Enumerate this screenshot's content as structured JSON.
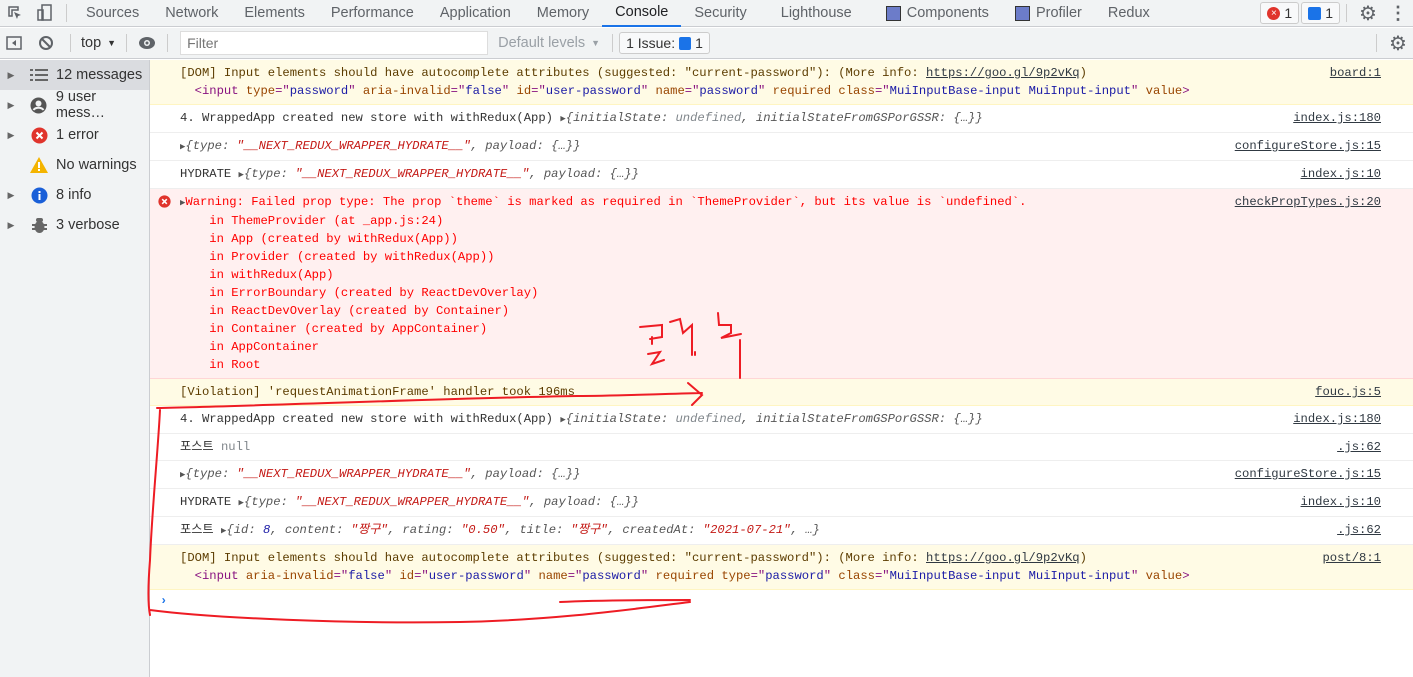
{
  "tabs": [
    "Sources",
    "Network",
    "Elements",
    "Performance",
    "Application",
    "Memory",
    "Console",
    "Security",
    "Lighthouse",
    "Components",
    "Profiler",
    "Redux"
  ],
  "active_tab": "Console",
  "error_count": "1",
  "issue_count": "1",
  "toolbar": {
    "context": "top",
    "filter_placeholder": "Filter",
    "levels": "Default levels",
    "issues_label": "1 Issue:",
    "issues_count": "1"
  },
  "sidebar": [
    {
      "label": "12 messages",
      "icon": "list-icon"
    },
    {
      "label": "9 user mess…",
      "icon": "user-icon"
    },
    {
      "label": "1 error",
      "icon": "error-icon"
    },
    {
      "label": "No warnings",
      "icon": "warning-icon"
    },
    {
      "label": "8 info",
      "icon": "info-icon"
    },
    {
      "label": "3 verbose",
      "icon": "bug-icon"
    }
  ],
  "messages": [
    {
      "kind": "warn",
      "source": "board:1",
      "lines": [
        [
          [
            "[DOM] Input elements should have autocomplete attributes (suggested: \"current-password\"): (More info: ",
            ""
          ],
          [
            "https://goo.gl/9p2vKq",
            "lnk"
          ],
          [
            ")",
            ""
          ]
        ],
        [
          [
            "  <input ",
            "tg"
          ],
          [
            "type",
            "at"
          ],
          [
            "=\"",
            "tg"
          ],
          [
            "password",
            "av"
          ],
          [
            "\" ",
            "tg"
          ],
          [
            "aria-invalid",
            "at"
          ],
          [
            "=\"",
            "tg"
          ],
          [
            "false",
            "av"
          ],
          [
            "\" ",
            "tg"
          ],
          [
            "id",
            "at"
          ],
          [
            "=\"",
            "tg"
          ],
          [
            "user-password",
            "av"
          ],
          [
            "\" ",
            "tg"
          ],
          [
            "name",
            "at"
          ],
          [
            "=\"",
            "tg"
          ],
          [
            "password",
            "av"
          ],
          [
            "\" ",
            "tg"
          ],
          [
            "required class",
            "at"
          ],
          [
            "=\"",
            "tg"
          ],
          [
            "MuiInputBase-input MuiInput-input",
            "av"
          ],
          [
            "\" ",
            "tg"
          ],
          [
            "value",
            "at"
          ],
          [
            ">",
            "tg"
          ]
        ]
      ]
    },
    {
      "kind": "log",
      "source": "index.js:180",
      "lines": [
        [
          [
            "4. WrappedApp created new store with withRedux(App) ",
            ""
          ],
          [
            "▶",
            "tri"
          ],
          [
            "{",
            "k"
          ],
          [
            "initialState: ",
            "k"
          ],
          [
            "undefined",
            "u"
          ],
          [
            ", initialStateFromGSPorGSSR: {…}}",
            "k"
          ]
        ]
      ]
    },
    {
      "kind": "log",
      "source": "configureStore.js:15",
      "lines": [
        [
          [
            "▶",
            "tri"
          ],
          [
            "{type: ",
            "k"
          ],
          [
            "\"__NEXT_REDUX_WRAPPER_HYDRATE__\"",
            "s"
          ],
          [
            ", payload: {…}}",
            "k"
          ]
        ]
      ]
    },
    {
      "kind": "log",
      "source": "index.js:10",
      "lines": [
        [
          [
            "HYDRATE ",
            ""
          ],
          [
            "▶",
            "tri"
          ],
          [
            "{type: ",
            "k"
          ],
          [
            "\"__NEXT_REDUX_WRAPPER_HYDRATE__\"",
            "s"
          ],
          [
            ", payload: {…}}",
            "k"
          ]
        ]
      ]
    },
    {
      "kind": "err",
      "source": "checkPropTypes.js:20",
      "lines": [
        [
          [
            "▶",
            "tri"
          ],
          [
            "Warning: Failed prop type: The prop `theme` is marked as required in `ThemeProvider`, but its value is `undefined`.",
            ""
          ]
        ],
        [
          [
            "    in ThemeProvider (at _app.js:24)",
            ""
          ]
        ],
        [
          [
            "    in App (created by withRedux(App))",
            ""
          ]
        ],
        [
          [
            "    in Provider (created by withRedux(App))",
            ""
          ]
        ],
        [
          [
            "    in withRedux(App)",
            ""
          ]
        ],
        [
          [
            "    in ErrorBoundary (created by ReactDevOverlay)",
            ""
          ]
        ],
        [
          [
            "    in ReactDevOverlay (created by Container)",
            ""
          ]
        ],
        [
          [
            "    in Container (created by AppContainer)",
            ""
          ]
        ],
        [
          [
            "    in AppContainer",
            ""
          ]
        ],
        [
          [
            "    in Root",
            ""
          ]
        ]
      ]
    },
    {
      "kind": "warn",
      "source": "fouc.js:5",
      "lines": [
        [
          [
            "[Violation] 'requestAnimationFrame' handler took 196ms",
            ""
          ]
        ]
      ]
    },
    {
      "kind": "log",
      "source": "index.js:180",
      "lines": [
        [
          [
            "4. WrappedApp created new store with withRedux(App) ",
            ""
          ],
          [
            "▶",
            "tri"
          ],
          [
            "{",
            "k"
          ],
          [
            "initialState: ",
            "k"
          ],
          [
            "undefined",
            "u"
          ],
          [
            ", initialStateFromGSPorGSSR: {…}}",
            "k"
          ]
        ]
      ]
    },
    {
      "kind": "log",
      "source": ".js:62",
      "lines": [
        [
          [
            "포스트 ",
            ""
          ],
          [
            "null",
            "null"
          ]
        ]
      ]
    },
    {
      "kind": "log",
      "source": "configureStore.js:15",
      "lines": [
        [
          [
            "▶",
            "tri"
          ],
          [
            "{type: ",
            "k"
          ],
          [
            "\"__NEXT_REDUX_WRAPPER_HYDRATE__\"",
            "s"
          ],
          [
            ", payload: {…}}",
            "k"
          ]
        ]
      ]
    },
    {
      "kind": "log",
      "source": "index.js:10",
      "lines": [
        [
          [
            "HYDRATE ",
            ""
          ],
          [
            "▶",
            "tri"
          ],
          [
            "{type: ",
            "k"
          ],
          [
            "\"__NEXT_REDUX_WRAPPER_HYDRATE__\"",
            "s"
          ],
          [
            ", payload: {…}}",
            "k"
          ]
        ]
      ]
    },
    {
      "kind": "log",
      "source": ".js:62",
      "lines": [
        [
          [
            "포스트 ",
            ""
          ],
          [
            "▶",
            "tri"
          ],
          [
            "{id: ",
            "k"
          ],
          [
            "8",
            "n"
          ],
          [
            ", content: ",
            "k"
          ],
          [
            "\"짱구\"",
            "s"
          ],
          [
            ", rating: ",
            "k"
          ],
          [
            "\"0.50\"",
            "s"
          ],
          [
            ", title: ",
            "k"
          ],
          [
            "\"짱구\"",
            "s"
          ],
          [
            ", createdAt: ",
            "k"
          ],
          [
            "\"2021-07-21\"",
            "s"
          ],
          [
            ", …}",
            "k"
          ]
        ]
      ]
    },
    {
      "kind": "warn",
      "source": "post/8:1",
      "lines": [
        [
          [
            "[DOM] Input elements should have autocomplete attributes (suggested: \"current-password\"): (More info: ",
            ""
          ],
          [
            "https://goo.gl/9p2vKq",
            "lnk"
          ],
          [
            ")",
            ""
          ]
        ],
        [
          [
            "  <input ",
            "tg"
          ],
          [
            "aria-invalid",
            "at"
          ],
          [
            "=\"",
            "tg"
          ],
          [
            "false",
            "av"
          ],
          [
            "\" ",
            "tg"
          ],
          [
            "id",
            "at"
          ],
          [
            "=\"",
            "tg"
          ],
          [
            "user-password",
            "av"
          ],
          [
            "\" ",
            "tg"
          ],
          [
            "name",
            "at"
          ],
          [
            "=\"",
            "tg"
          ],
          [
            "password",
            "av"
          ],
          [
            "\" ",
            "tg"
          ],
          [
            "required type",
            "at"
          ],
          [
            "=\"",
            "tg"
          ],
          [
            "password",
            "av"
          ],
          [
            "\" ",
            "tg"
          ],
          [
            "class",
            "at"
          ],
          [
            "=\"",
            "tg"
          ],
          [
            "MuiInputBase-input MuiInput-input",
            "av"
          ],
          [
            "\" ",
            "tg"
          ],
          [
            "value",
            "at"
          ],
          [
            ">",
            "tg"
          ]
        ]
      ]
    }
  ],
  "prompt": "›",
  "colors": {
    "accent": "#1a73e8",
    "error": "#ff0000",
    "annotation": "#ee1c24"
  }
}
